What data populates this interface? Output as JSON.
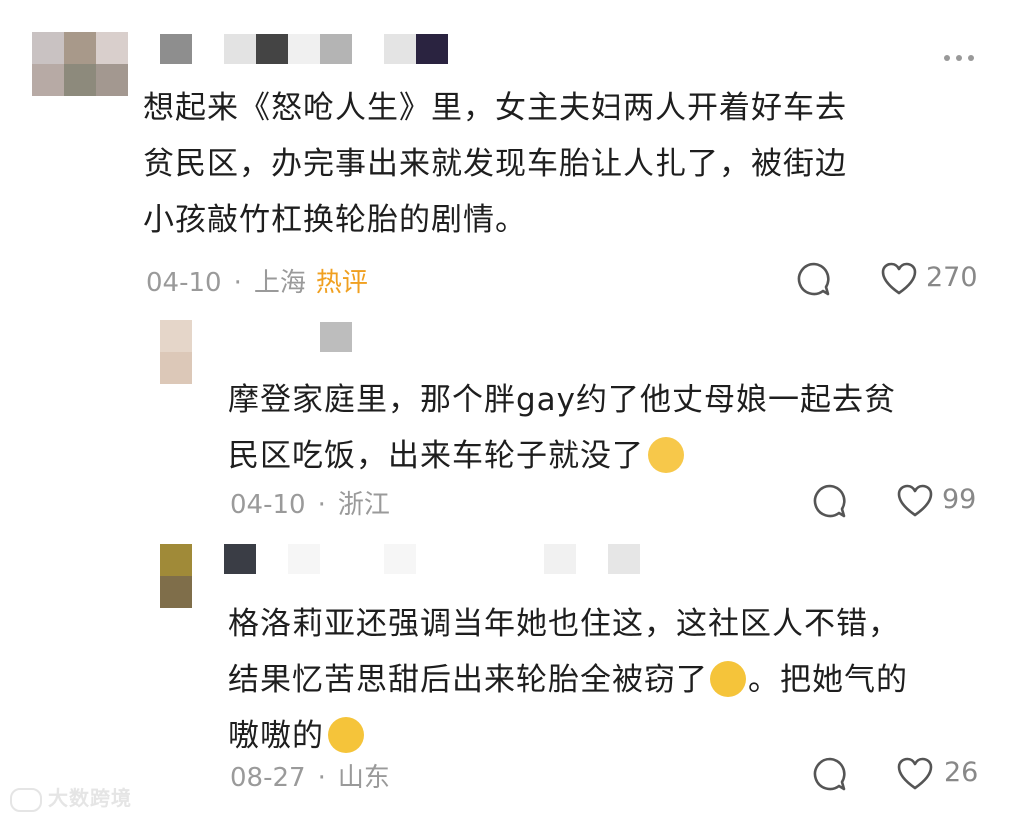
{
  "comments": [
    {
      "text_lines": [
        "想起来《怒呛人生》里，女主夫妇两人开着好车去",
        "贫民区，办完事出来就发现车胎让人扎了，被街边",
        "小孩敲竹杠换轮胎的剧情。"
      ],
      "date": "04-10",
      "location": "上海",
      "tag": "热评",
      "likes": "270"
    },
    {
      "text_lines": [
        "摩登家庭里，那个胖gay约了他丈母娘一起去贫",
        "民区吃饭，出来车轮子就没了"
      ],
      "date": "04-10",
      "location": "浙江",
      "likes": "99"
    },
    {
      "text_lines": [
        "格洛莉亚还强调当年她也住这，这社区人不错，",
        "结果忆苦思甜后出来轮胎全被窃了",
        "。把她气的",
        "嗷嗷的"
      ],
      "date": "08-27",
      "location": "山东",
      "likes": "26"
    }
  ],
  "separator": "·",
  "watermark": "大数跨境",
  "icons": {
    "reply": "comment-bubble-icon",
    "like": "heart-outline-icon",
    "more": "more-dots-icon"
  },
  "colors": {
    "hot_tag": "#f0a020",
    "meta": "#9a9a9a"
  }
}
